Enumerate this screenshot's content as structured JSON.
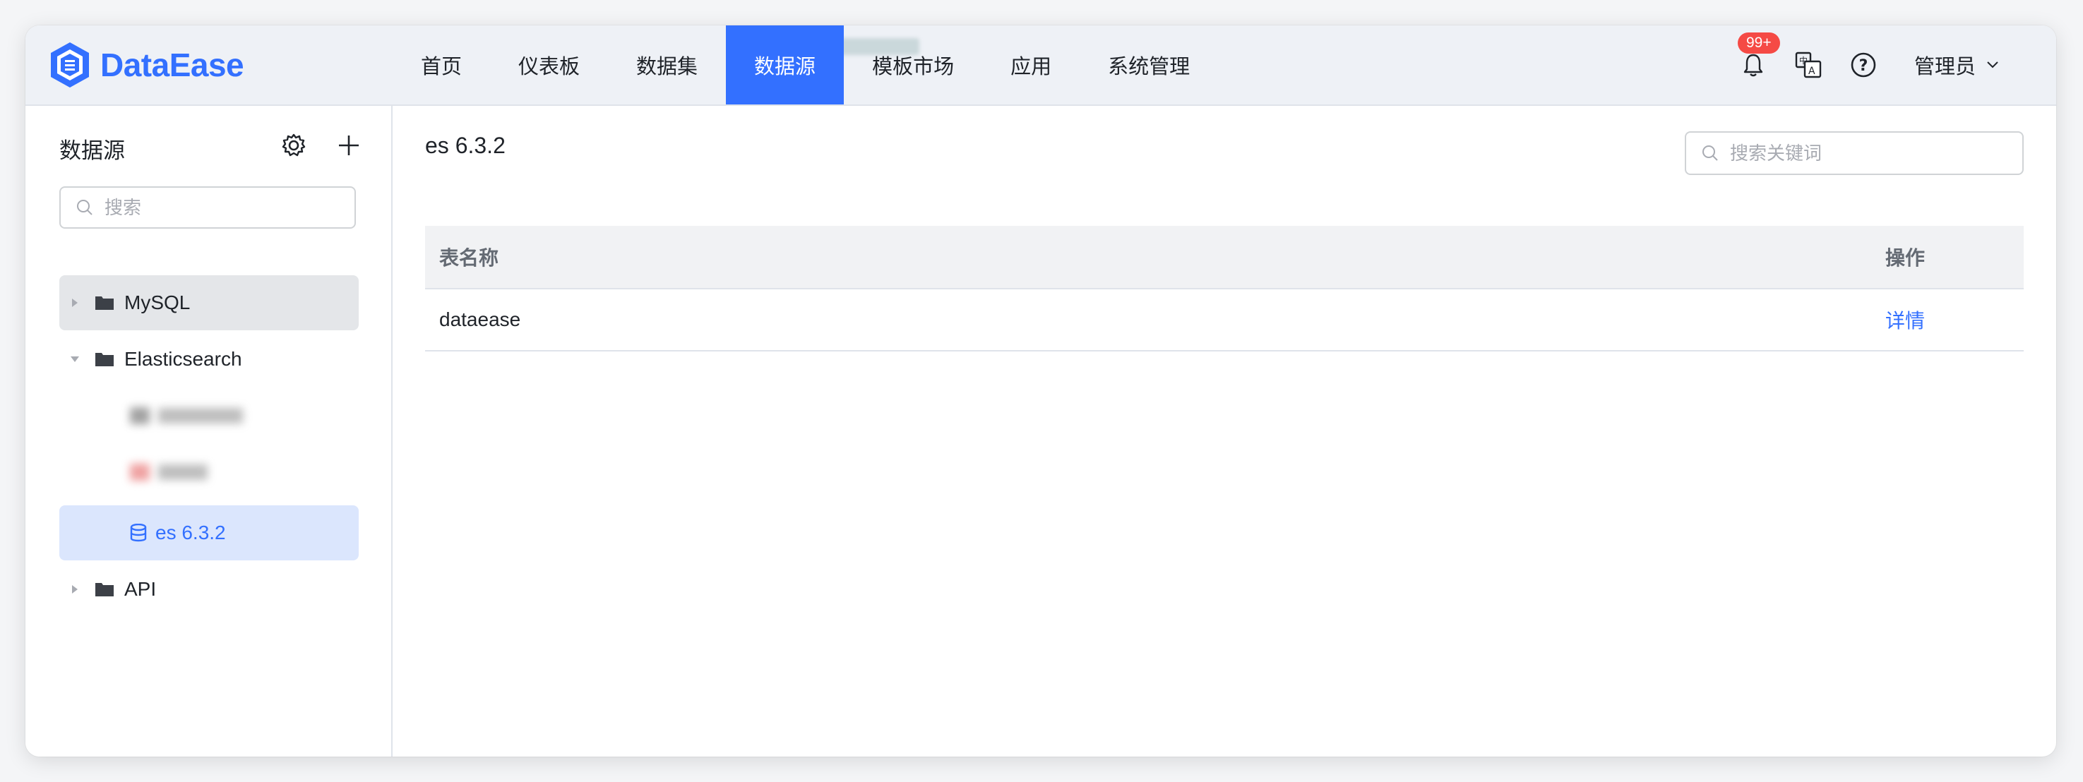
{
  "app": {
    "logo_text": "DataEase",
    "brand_color": "#3370ff"
  },
  "nav": {
    "items": [
      {
        "label": "首页"
      },
      {
        "label": "仪表板"
      },
      {
        "label": "数据集"
      },
      {
        "label": "数据源",
        "active": true
      },
      {
        "label": "模板市场"
      },
      {
        "label": "应用"
      },
      {
        "label": "系统管理"
      }
    ]
  },
  "header": {
    "notification_badge": "99+",
    "icons": [
      "bell-icon",
      "translate-icon",
      "help-icon"
    ],
    "user_label": "管理员"
  },
  "sidebar": {
    "title": "数据源",
    "search_placeholder": "搜索",
    "tree": [
      {
        "label": "MySQL",
        "type": "folder",
        "expanded": false
      },
      {
        "label": "Elasticsearch",
        "type": "folder",
        "expanded": true
      },
      {
        "label": "es 6.3.2",
        "type": "datasource",
        "selected": true
      },
      {
        "label": "API",
        "type": "folder",
        "expanded": false
      }
    ]
  },
  "main": {
    "title": "es 6.3.2",
    "search_placeholder": "搜索关键词",
    "table": {
      "headers": {
        "name": "表名称",
        "op": "操作"
      },
      "rows": [
        {
          "name": "dataease",
          "op": "详情"
        }
      ]
    }
  }
}
